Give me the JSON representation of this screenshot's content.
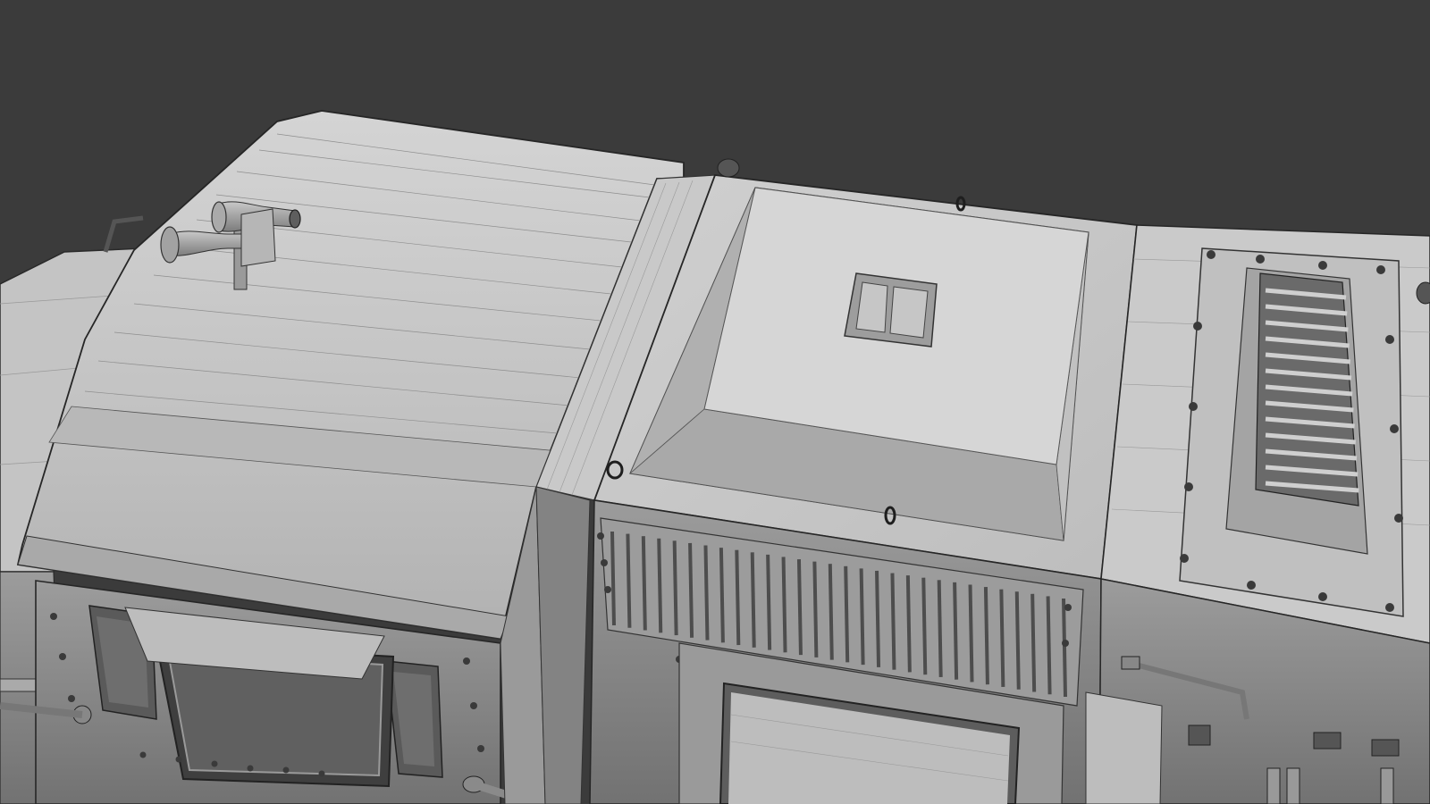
{
  "scene": {
    "subject": "locomotive-3d-wireframe-render",
    "render_style": "clay-shaded-with-wireframe",
    "colors": {
      "background": "#3b3b3b",
      "surface_light": "#cfcfcf",
      "surface_mid": "#b4b4b4",
      "surface_dark": "#8f8f8f",
      "shadow": "#5e5e5e",
      "edge": "#262626"
    },
    "icons": [
      "air-horn-icon",
      "lifting-eye-icon",
      "rivet-icon",
      "vent-grille-icon",
      "hatch-handle-icon"
    ]
  }
}
